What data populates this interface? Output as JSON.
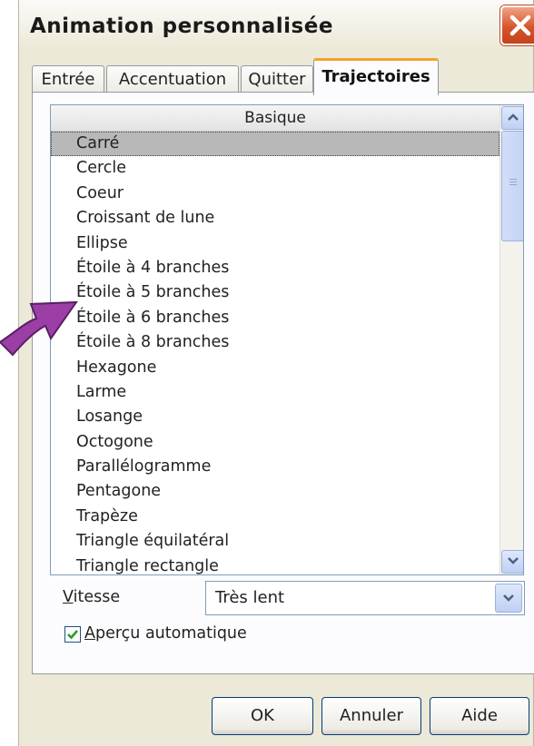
{
  "window": {
    "title": "Animation personnalisée"
  },
  "tabs": [
    {
      "label": "Entrée",
      "active": false
    },
    {
      "label": "Accentuation",
      "active": false
    },
    {
      "label": "Quitter",
      "active": false
    },
    {
      "label": "Trajectoires",
      "active": true
    }
  ],
  "list": {
    "header": "Basique",
    "selected": "Carré",
    "items": [
      "Carré",
      "Cercle",
      "Coeur",
      "Croissant de lune",
      "Ellipse",
      "Étoile à 4 branches",
      "Étoile à 5 branches",
      "Étoile à 6 branches",
      "Étoile à 8 branches",
      "Hexagone",
      "Larme",
      "Losange",
      "Octogone",
      "Parallélogramme",
      "Pentagone",
      "Trapèze",
      "Triangle équilatéral",
      "Triangle rectangle"
    ]
  },
  "speed": {
    "label_first": "V",
    "label_rest": "itesse",
    "value": "Très lent"
  },
  "preview": {
    "checked": true,
    "label_first": "A",
    "label_rest": "perçu automatique"
  },
  "buttons": {
    "ok": "OK",
    "cancel": "Annuler",
    "help": "Aide"
  },
  "colors": {
    "dialog_bg": "#ece9d8",
    "close_red": "#d5552b",
    "active_tab_accent": "#f1a22d",
    "selection": "#b8b8b8",
    "annotation_arrow": "#9b3fa6"
  },
  "icons": {
    "close": "close-x-icon",
    "scroll_up": "chevron-up-icon",
    "scroll_down": "chevron-down-icon",
    "dropdown": "chevron-down-icon",
    "check": "checkmark-icon",
    "arrow": "curved-arrow-icon"
  }
}
